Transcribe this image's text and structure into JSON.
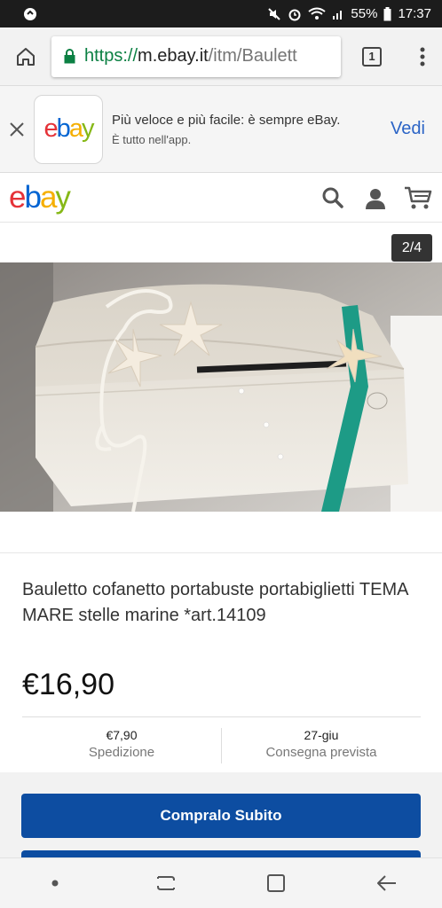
{
  "status_bar": {
    "battery": "55%",
    "time": "17:37"
  },
  "browser": {
    "url_scheme": "https://",
    "url_host": "m.ebay.it",
    "url_path": "/itm/Baulett",
    "tab_count": "1"
  },
  "app_banner": {
    "logo": "ebay",
    "title": "Più veloce e più facile: è sempre eBay.",
    "subtitle": "È tutto nell'app.",
    "view_label": "Vedi"
  },
  "header": {
    "logo": "ebay"
  },
  "gallery": {
    "counter": "2/4"
  },
  "product": {
    "title": "Bauletto cofanetto portabuste portabiglietti TEMA MARE stelle marine *art.14109",
    "price": "€16,90",
    "shipping_value": "€7,90",
    "shipping_label": "Spedizione",
    "delivery_value": "27-giu",
    "delivery_label": "Consegna prevista",
    "buy_now_label": "Compralo Subito"
  },
  "colors": {
    "ebay_e": "#e53238",
    "ebay_b": "#0064d2",
    "ebay_a": "#f5af02",
    "ebay_y": "#86b817",
    "buy_button": "#0d4da1",
    "link": "#2b64c6"
  }
}
